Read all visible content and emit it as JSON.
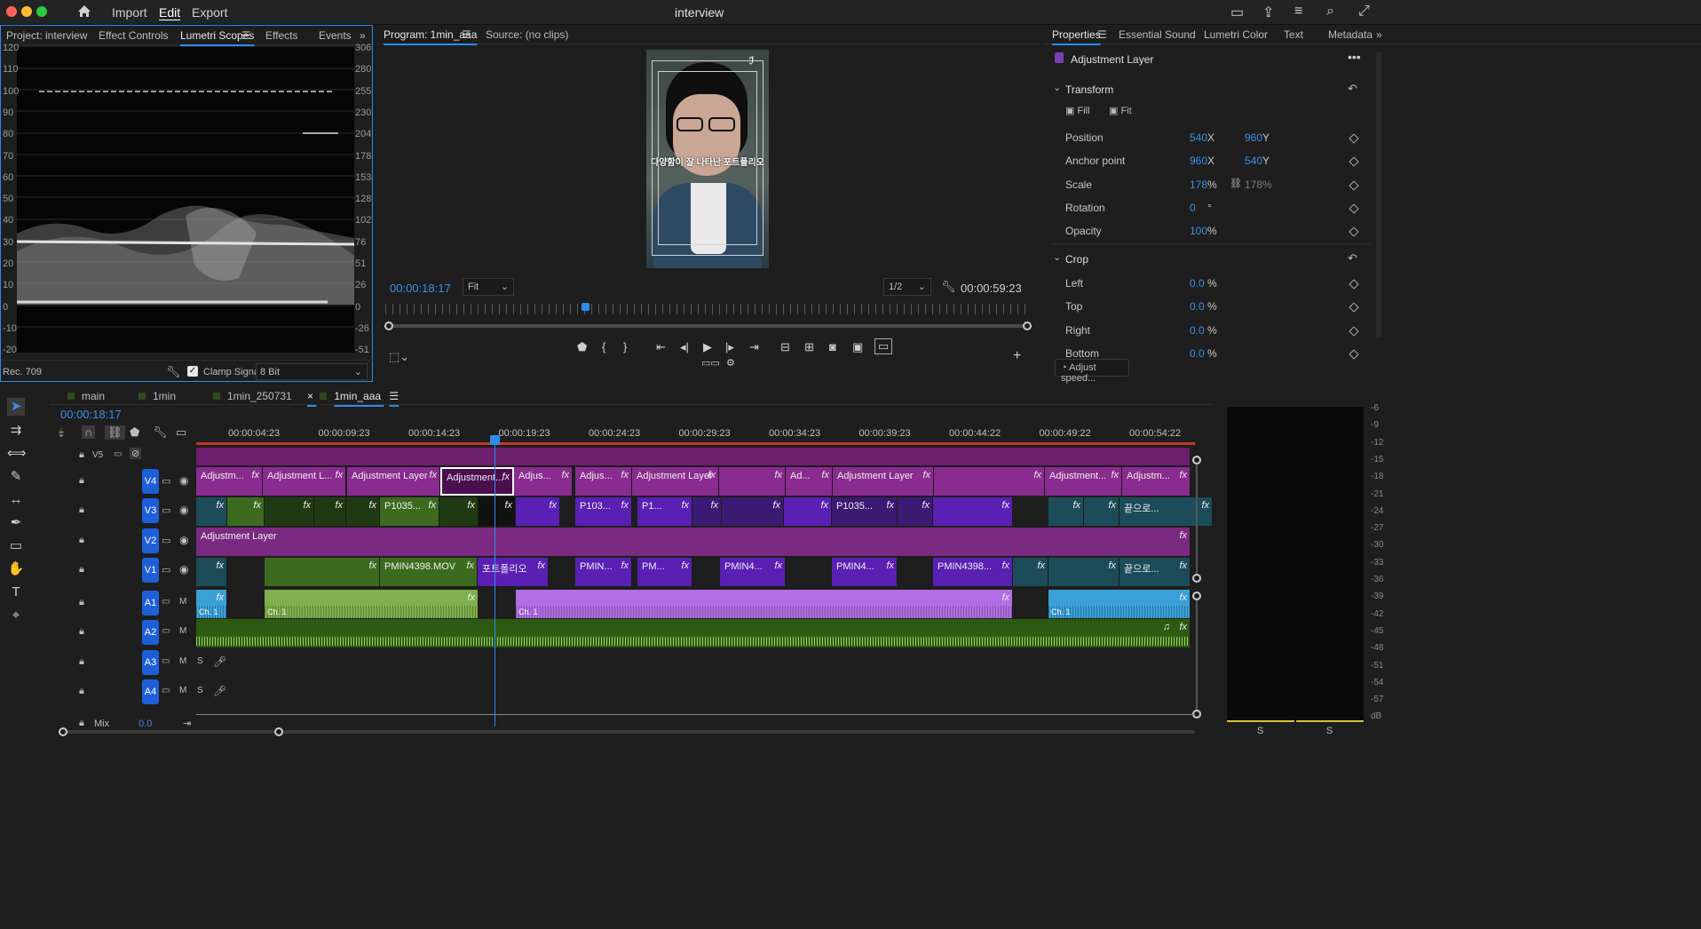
{
  "app": {
    "title": "interview",
    "menu": [
      "Import",
      "Edit",
      "Export"
    ],
    "active_menu": "Edit"
  },
  "colors": {
    "accent": "#2d8ceb",
    "adjustment": "#8a2b8f",
    "video_green": "#3c6b1f",
    "video_purple": "#5a1fb3",
    "audio_green": "#7fb04d",
    "audio_purple": "#b36ee6",
    "audio_blue": "#3aa0d8"
  },
  "left_panel": {
    "tabs": [
      "Project: interview",
      "Effect Controls",
      "Lumetri Scopes",
      "Effects",
      "Events"
    ],
    "active_tab": "Lumetri Scopes",
    "scope": {
      "left_axis": [
        "120",
        "110",
        "100",
        "90",
        "80",
        "70",
        "60",
        "50",
        "40",
        "30",
        "20",
        "10",
        "0",
        "-10",
        "-20"
      ],
      "right_axis": [
        "306",
        "280",
        "255",
        "230",
        "204",
        "178",
        "153",
        "128",
        "102",
        "76",
        "51",
        "26",
        "0",
        "-26",
        "-51"
      ]
    },
    "footer": {
      "colorspace": "Rec. 709",
      "clamp_label": "Clamp Signal",
      "clamp_checked": true,
      "bit_depth": "8 Bit"
    }
  },
  "monitor": {
    "tabs": [
      "Program: 1min_aaa",
      "Source: (no clips)"
    ],
    "active_tab": "Program: 1min_aaa",
    "timecode": "00:00:18:17",
    "fit": "Fit",
    "resolution": "1/2",
    "duration": "00:00:59:23",
    "caption": "다양함이 잘 나타난 포트폴리오",
    "playhead_progress": 0.31
  },
  "properties": {
    "tabs": [
      "Properties",
      "Essential Sound",
      "Lumetri Color",
      "Text",
      "Metadata"
    ],
    "active_tab": "Properties",
    "layer_title": "Adjustment Layer",
    "transform": {
      "label": "Transform",
      "fill": "Fill",
      "fit": "Fit",
      "rows": [
        {
          "name": "Position",
          "v1": "540",
          "u1": "X",
          "v2": "960",
          "u2": "Y"
        },
        {
          "name": "Anchor point",
          "v1": "960",
          "u1": "X",
          "v2": "540",
          "u2": "Y"
        },
        {
          "name": "Scale",
          "v1": "178",
          "u1": "%",
          "v2": "178",
          "u2": "%"
        },
        {
          "name": "Rotation",
          "v1": "0",
          "u1": "°",
          "v2": "",
          "u2": ""
        },
        {
          "name": "Opacity",
          "v1": "100",
          "u1": "%",
          "v2": "",
          "u2": ""
        }
      ]
    },
    "crop": {
      "label": "Crop",
      "rows": [
        {
          "name": "Left",
          "v1": "0.0",
          "u1": "%"
        },
        {
          "name": "Top",
          "v1": "0.0",
          "u1": "%"
        },
        {
          "name": "Right",
          "v1": "0.0",
          "u1": "%"
        },
        {
          "name": "Bottom",
          "v1": "0.0",
          "u1": "%"
        }
      ]
    },
    "adjust_speed": "Adjust speed..."
  },
  "timeline": {
    "sequence_tabs": [
      "main",
      "1min",
      "1min_250731",
      "1min_aaa"
    ],
    "active_sequence": "1min_aaa",
    "timecode": "00:00:18:17",
    "ruler": [
      "00:00:04:23",
      "00:00:09:23",
      "00:00:14:23",
      "00:00:19:23",
      "00:00:24:23",
      "00:00:29:23",
      "00:00:34:23",
      "00:00:39:23",
      "00:00:44:22",
      "00:00:49:22",
      "00:00:54:22"
    ],
    "video_tracks": [
      "V5",
      "V4",
      "V3",
      "V2",
      "V1"
    ],
    "audio_tracks": [
      "A1",
      "A2",
      "A3",
      "A4"
    ],
    "mix_label": "Mix",
    "mix_value": "0.0",
    "v4_clips": [
      "Adjustm...",
      "Adjustment L...",
      "Adjustment Layer",
      "Adjustment...",
      "Adjus...",
      "Adjus...",
      "Adjustment Layer",
      "Ad...",
      "Adjustment Layer",
      "Adjustment...",
      "Adjustm..."
    ],
    "v3_clips": [
      "P1035...",
      "P103...",
      "P1...",
      "P1035...",
      "끝으로..."
    ],
    "v2_clip": "Adjustment Layer",
    "v1_clips": [
      "PMIN4398.MOV",
      "포트폴리오",
      "PMIN...",
      "PM...",
      "PMIN4...",
      "PMIN4...",
      "PMIN4398...",
      "끝으로..."
    ],
    "audio_channel": "Ch. 1"
  },
  "meters": {
    "scale": [
      "-6",
      "-9",
      "-12",
      "-15",
      "-18",
      "-21",
      "-24",
      "-27",
      "-30",
      "-33",
      "-36",
      "-39",
      "-42",
      "-45",
      "-48",
      "-51",
      "-54",
      "-57",
      "dB"
    ],
    "solo": [
      "S",
      "S"
    ]
  }
}
